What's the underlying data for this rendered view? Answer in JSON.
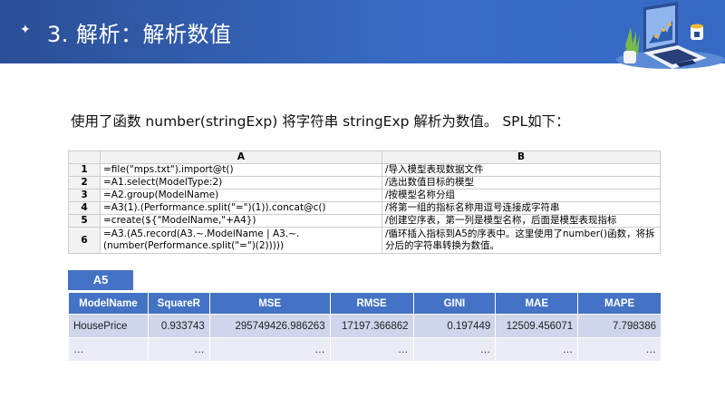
{
  "header": {
    "title": "3. 解析：解析数值",
    "bullet_icon": "four-point-star"
  },
  "intro": "使用了函数 number(stringExp) 将字符串 stringExp 解析为数值。 SPL如下：",
  "code_table": {
    "columns": [
      "A",
      "B"
    ],
    "rows": [
      {
        "n": "1",
        "a": "=file(\"mps.txt\").import@t()",
        "b": "/导入模型表现数据文件"
      },
      {
        "n": "2",
        "a": "=A1.select(ModelType:2)",
        "b": "/选出数值目标的模型"
      },
      {
        "n": "3",
        "a": "=A2.group(ModelName)",
        "b": "/按模型名称分组"
      },
      {
        "n": "4",
        "a": "=A3(1).(Performance.split(\"=\")(1)).concat@c()",
        "b": "/将第一组的指标名称用逗号连接成字符串"
      },
      {
        "n": "5",
        "a": "=create(${\"ModelName,\"+A4})",
        "b": "/创建空序表，第一列是模型名称，后面是模型表现指标"
      },
      {
        "n": "6",
        "a": "=A3.(A5.record(A3.~.ModelName | A3.~.(number(Performance.split(\"=\")(2)))))",
        "b": "/循环插入指标到A5的序表中。这里使用了number()函数，将拆分后的字符串转换为数值。"
      }
    ]
  },
  "result": {
    "label": "A5",
    "columns": [
      "ModelName",
      "SquareR",
      "MSE",
      "RMSE",
      "GINI",
      "MAE",
      "MAPE"
    ],
    "rows": [
      [
        "HousePrice",
        "0.933743",
        "295749426.986263",
        "17197.366862",
        "0.197449",
        "12509.456071",
        "7.798386"
      ],
      [
        "…",
        "…",
        "…",
        "…",
        "…",
        "…",
        "…"
      ]
    ]
  }
}
